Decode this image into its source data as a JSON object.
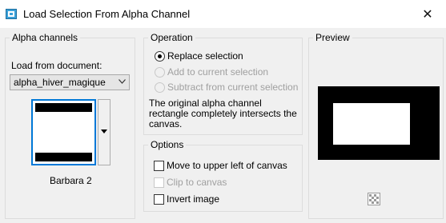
{
  "window": {
    "title": "Load Selection From Alpha Channel",
    "close_glyph": "✕"
  },
  "alpha_channels": {
    "label": "Alpha channels",
    "load_from_label": "Load from document:",
    "document": "alpha_hiver_magique",
    "channel_name": "Barbara 2"
  },
  "operation": {
    "label": "Operation",
    "options": [
      {
        "label": "Replace selection",
        "selected": true,
        "enabled": true
      },
      {
        "label": "Add to current selection",
        "selected": false,
        "enabled": false
      },
      {
        "label": "Subtract from current selection",
        "selected": false,
        "enabled": false
      }
    ],
    "info_line1": "The original alpha channel",
    "info_line2": "rectangle completely intersects the",
    "info_line3": "canvas."
  },
  "options": {
    "label": "Options",
    "items": [
      {
        "label": "Move to upper left of canvas",
        "checked": false,
        "enabled": true
      },
      {
        "label": "Clip to canvas",
        "checked": false,
        "enabled": false
      },
      {
        "label": "Invert image",
        "checked": false,
        "enabled": true
      }
    ]
  },
  "preview": {
    "label": "Preview"
  },
  "icons": {
    "app": "selection-icon",
    "close": "close-icon",
    "dropdown": "chevron-down-icon",
    "checker": "checkerboard-icon"
  },
  "colors": {
    "accent": "#0078d7",
    "disabled": "#a0a0a0",
    "background": "#f0f0f0"
  }
}
